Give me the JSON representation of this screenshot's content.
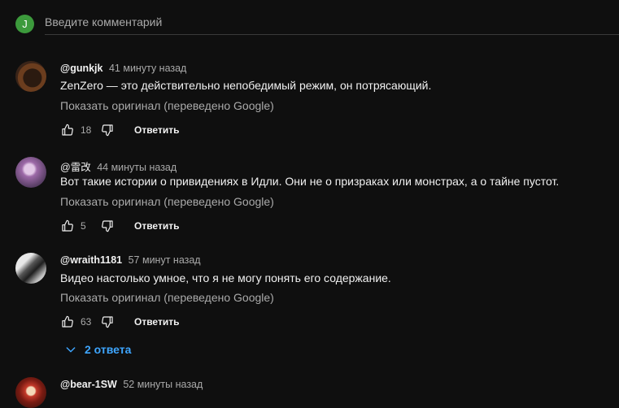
{
  "composer": {
    "avatar_letter": "J",
    "placeholder": "Введите комментарий"
  },
  "comments": [
    {
      "author": "@gunkjk",
      "time": "41 минуту назад",
      "text": "ZenZero — это действительно непобедимый режим, он потрясающий.",
      "translate_label": "Показать оригинал (переведено Google)",
      "likes": "18",
      "reply_label": "Ответить"
    },
    {
      "author": "@雷改",
      "time": "44 минуты назад",
      "text": "Вот такие истории о привидениях в Идли. Они не о призраках или монстрах, а о тайне пустот.",
      "translate_label": "Показать оригинал (переведено Google)",
      "likes": "5",
      "reply_label": "Ответить"
    },
    {
      "author": "@wraith1181",
      "time": "57 минут назад",
      "text": "Видео настолько умное, что я не могу понять его содержание.",
      "translate_label": "Показать оригинал (переведено Google)",
      "likes": "63",
      "reply_label": "Ответить",
      "replies_label": "2 ответа"
    },
    {
      "author": "@bear-1SW",
      "time": "52 минуты назад"
    }
  ],
  "icons": {
    "like": "thumb-up-icon",
    "dislike": "thumb-down-icon",
    "expand": "chevron-down-icon"
  },
  "colors": {
    "background": "#0f0f0f",
    "accent": "#3ea6ff",
    "avatar": "#3c9a3c"
  }
}
